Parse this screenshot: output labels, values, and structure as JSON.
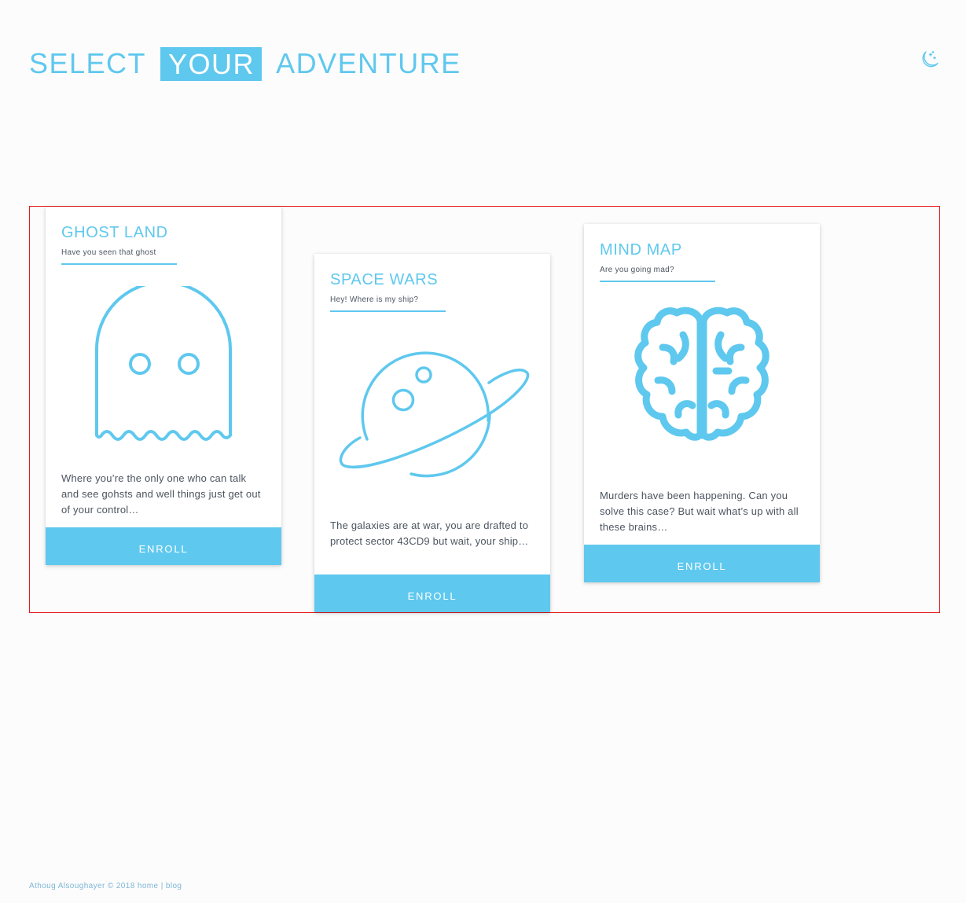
{
  "header": {
    "title_words": [
      "SELECT",
      "YOUR",
      "ADVENTURE"
    ],
    "theme_toggle_icon": "moon-stars-icon"
  },
  "colors": {
    "accent": "#5fc8ee",
    "text": "#4c5560",
    "background": "#fcfcfc",
    "region_outline": "#e21b1b"
  },
  "cards": [
    {
      "title": "GHOST LAND",
      "subtitle": "Have you seen that ghost",
      "icon": "ghost-icon",
      "description": "Where you’re the only one who can talk and see gohsts and well things just get out of your control…",
      "button": "ENROLL"
    },
    {
      "title": "SPACE WARS",
      "subtitle": "Hey! Where is my ship?",
      "icon": "planet-icon",
      "description": "The galaxies are at war, you are drafted to protect sector 43CD9 but wait, your ship…",
      "button": "ENROLL"
    },
    {
      "title": "MIND MAP",
      "subtitle": "Are you going mad?",
      "icon": "brain-icon",
      "description": "Murders have been happening. Can you solve this case? But wait what’s up with all these brains…",
      "button": "ENROLL"
    }
  ],
  "footer": {
    "copyright": "Athoug Alsoughayer © 2018",
    "home_link": "home",
    "separator": "|",
    "blog_link": "blog"
  }
}
